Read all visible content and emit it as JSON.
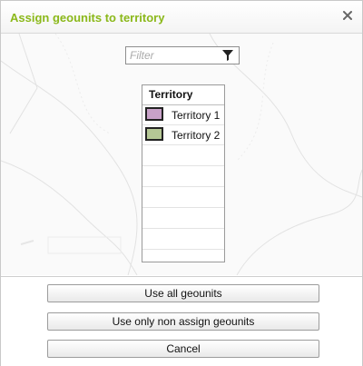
{
  "dialog": {
    "title": "Assign geounits to territory",
    "accent_color": "#8bb81a"
  },
  "filter": {
    "placeholder": "Filter",
    "value": ""
  },
  "territory_table": {
    "header": "Territory",
    "rows": [
      {
        "label": "Territory 1",
        "color": "#c8a2c8"
      },
      {
        "label": "Territory 2",
        "color": "#b5c795"
      }
    ]
  },
  "buttons": {
    "use_all": "Use all geounits",
    "use_non_assigned": "Use only non assign geounits",
    "cancel": "Cancel"
  },
  "icons": {
    "close": "close-icon",
    "filter": "funnel-icon"
  }
}
